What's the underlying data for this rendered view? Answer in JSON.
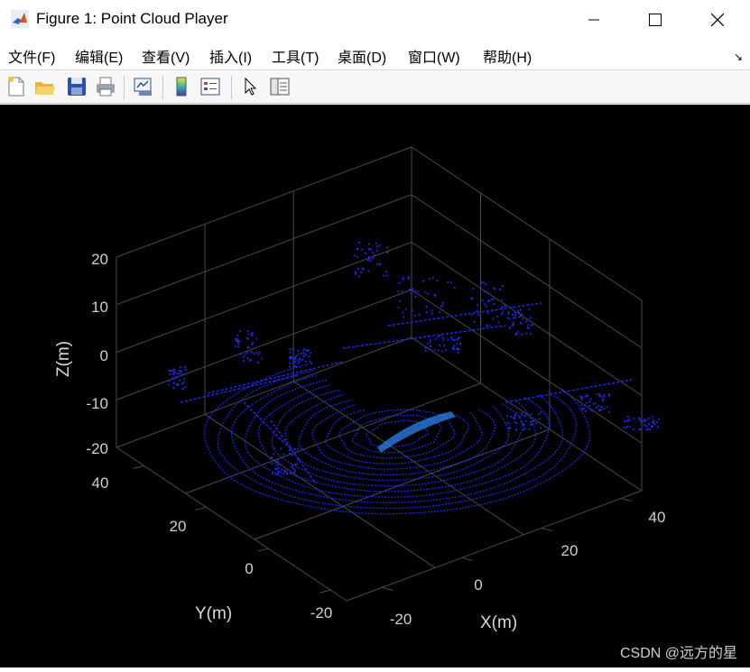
{
  "window": {
    "title": "Figure 1: Point Cloud Player",
    "controls": [
      "minimize",
      "maximize",
      "close"
    ]
  },
  "menu": {
    "items": [
      "文件(F)",
      "编辑(E)",
      "查看(V)",
      "插入(I)",
      "工具(T)",
      "桌面(D)",
      "窗口(W)",
      "帮助(H)"
    ],
    "corner_glyph": "↘"
  },
  "toolbar": {
    "buttons": [
      "new-figure-icon",
      "open-file-icon",
      "save-icon",
      "print-icon",
      "link-plot-icon",
      "insert-colorbar-icon",
      "insert-legend-icon",
      "edit-plot-pointer-icon",
      "property-editor-icon"
    ]
  },
  "plot": {
    "xlabel": "X(m)",
    "ylabel": "Y(m)",
    "zlabel": "Z(m)",
    "x_ticks": [
      "-20",
      "0",
      "20",
      "40"
    ],
    "y_ticks": [
      "-20",
      "0",
      "20",
      "40"
    ],
    "z_ticks": [
      "20",
      "10",
      "0",
      "-10",
      "-20"
    ],
    "background": "#000000",
    "grid_color": "#4a4a4a",
    "point_color": "#1a2cff"
  },
  "watermark": "CSDN @远方的星"
}
